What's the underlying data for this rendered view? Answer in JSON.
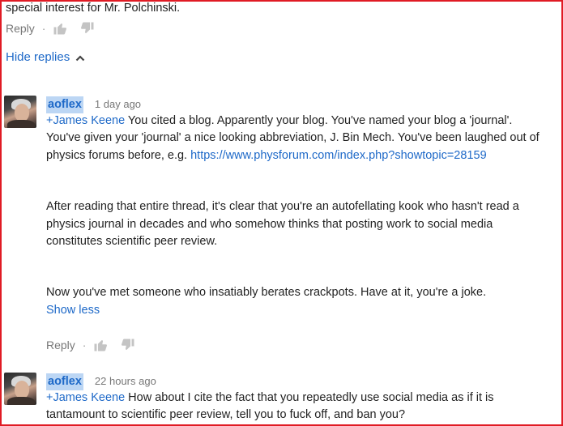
{
  "top_comment": {
    "text_tail": "special interest for Mr. Polchinski.",
    "reply_label": "Reply"
  },
  "hide_replies_label": "Hide replies",
  "comments": [
    {
      "author": "aoflex",
      "time": "1 day ago",
      "mention": "+James Keene",
      "p1_text": " You cited a blog. Apparently your blog. You've named your blog a 'journal'. You've given your 'journal' a nice looking abbreviation, J. Bin Mech. You've been laughed out of physics forums before, e.g. ",
      "p1_link": "https://www.physforum.com/index.php?showtopic=28159",
      "p2": "After reading that entire thread, it's clear that you're an autofellating kook who hasn't read a physics journal in decades and who somehow thinks that posting work to social media constitutes scientific peer review.",
      "p3": "Now you've met someone who insatiably berates crackpots. Have at it, you're a joke.",
      "show_less_label": "Show less",
      "reply_label": "Reply"
    },
    {
      "author": "aoflex",
      "time": "22 hours ago",
      "mention": "+James Keene",
      "text": " How about I cite the fact that you repeatedly use social media as if it is tantamount to scientific peer review, tell you to fuck off, and ban you?"
    }
  ],
  "colors": {
    "link": "#1e69c8",
    "author_highlight": "#bcd6f4",
    "border": "#e01b24"
  },
  "icons": [
    "thumbs-up-icon",
    "thumbs-down-icon",
    "chevron-up-icon"
  ]
}
